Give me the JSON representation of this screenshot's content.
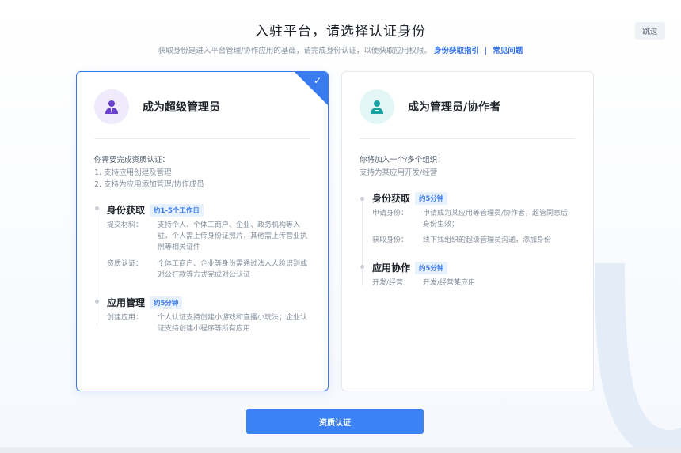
{
  "header": {
    "title": "入驻平台，请选择认证身份",
    "subtitle_text": "获取身份是进入平台管理/协作应用的基础，请完成身份认证，以便获取应用权限。",
    "guide_link": "身份获取指引",
    "separator": "|",
    "faq_link": "常见问题",
    "skip_label": "跳过"
  },
  "cards": {
    "admin": {
      "title": "成为超级管理员",
      "selected": true,
      "icon": "admin-user-icon",
      "requirement_title": "你需要完成资质认证：",
      "requirements": [
        "1. 支持应用创建及管理",
        "2. 支持为应用添加管理/协作成员"
      ],
      "steps": [
        {
          "title": "身份获取",
          "tag": "约1-5个工作日",
          "rows": [
            {
              "k": "提交材料：",
              "v": "支持个人、个体工商户、企业、政务机构等入驻，个人需上传身份证照片，其他需上传营业执照等相关证件"
            },
            {
              "k": "资质认证：",
              "v": "个体工商户、企业等身份需通过法人人脸识别或对公打款等方式完成对公认证"
            }
          ]
        },
        {
          "title": "应用管理",
          "tag": "约5分钟",
          "rows": [
            {
              "k": "创建应用：",
              "v": "个人认证支持创建小游戏和直播小玩法；企业认证支持创建小程序等所有应用"
            }
          ]
        }
      ]
    },
    "collab": {
      "title": "成为管理员/协作者",
      "selected": false,
      "icon": "collaborator-user-icon",
      "requirement_title": "你将加入一个/多个组织：",
      "requirements": [
        "支持为某应用开发/经营"
      ],
      "steps": [
        {
          "title": "身份获取",
          "tag": "约5分钟",
          "rows": [
            {
              "k": "申请身份：",
              "v": "申请成为某应用等管理员/协作者，超管同意后身份生效；"
            },
            {
              "k": "获取身份：",
              "v": "线下找组织的超级管理员沟通，添加身份"
            }
          ]
        },
        {
          "title": "应用协作",
          "tag": "约5分钟",
          "rows": [
            {
              "k": "开发/经营：",
              "v": "开发/经营某应用"
            }
          ]
        }
      ]
    }
  },
  "footer": {
    "submit_label": "资质认证"
  },
  "colors": {
    "accent": "#3b7bf0",
    "button": "#3b82f6",
    "purple_icon": "#6a3fd0",
    "teal_icon": "#1aa3a3"
  }
}
